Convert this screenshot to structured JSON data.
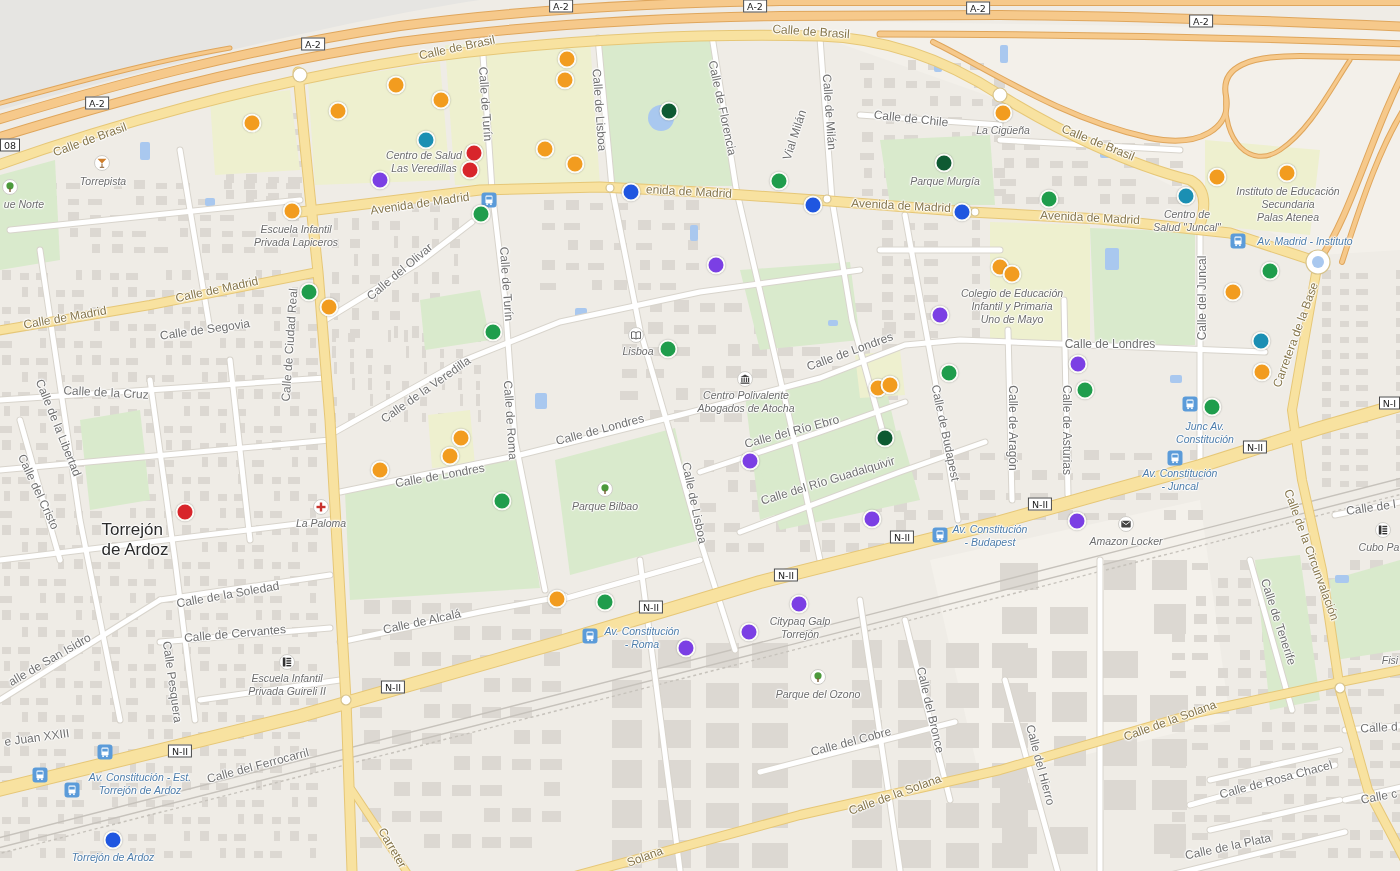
{
  "map": {
    "road_shields": [
      {
        "label": "A-2"
      },
      {
        "label": "A-2"
      },
      {
        "label": "A-2"
      },
      {
        "label": "A-2"
      },
      {
        "label": "A-2"
      },
      {
        "label": "A-2"
      },
      {
        "label": "08"
      },
      {
        "label": "N-I"
      },
      {
        "label": "N-II"
      },
      {
        "label": "N-II"
      },
      {
        "label": "N-II"
      },
      {
        "label": "N-II"
      },
      {
        "label": "N-II"
      },
      {
        "label": "N-II"
      },
      {
        "label": "N-II"
      }
    ],
    "streets": [
      {
        "name": "Calle de Brasil",
        "kind": "major"
      },
      {
        "name": "Calle de Brasil",
        "kind": "major"
      },
      {
        "name": "Calle de Florencia",
        "kind": "minor"
      },
      {
        "name": "Calle de Lisboa",
        "kind": "minor"
      },
      {
        "name": "Calle de Turín",
        "kind": "minor"
      },
      {
        "name": "Calle de Milán",
        "kind": "minor"
      },
      {
        "name": "Calle de Chile",
        "kind": "minor"
      },
      {
        "name": "Calle de Brasil",
        "kind": "major"
      },
      {
        "name": "Vial Milán",
        "kind": "minor"
      },
      {
        "name": "Calle de Brasil",
        "kind": "major"
      },
      {
        "name": "Avenida de Madrid",
        "kind": "major"
      },
      {
        "name": "enida de Madrid",
        "kind": "major"
      },
      {
        "name": "Avenida de Madrid",
        "kind": "major"
      },
      {
        "name": "Avenida de Madrid",
        "kind": "major"
      },
      {
        "name": "Calle del Olivar",
        "kind": "minor"
      },
      {
        "name": "Calle de Madrid",
        "kind": "major"
      },
      {
        "name": "Calle de Turín",
        "kind": "minor"
      },
      {
        "name": "Calle de Madrid",
        "kind": "major"
      },
      {
        "name": "Calle de Segovia",
        "kind": "minor"
      },
      {
        "name": "Carretera de la Base",
        "kind": "major"
      },
      {
        "name": "Calle del Juncal",
        "kind": "minor"
      },
      {
        "name": "Calle de Ciudad Real",
        "kind": "minor"
      },
      {
        "name": "Calle de Londres",
        "kind": "minor"
      },
      {
        "name": "Calle de Londres",
        "kind": "minor"
      },
      {
        "name": "Calle de la Cruz",
        "kind": "minor"
      },
      {
        "name": "Calle de la Veredilla",
        "kind": "minor"
      },
      {
        "name": "Calle de Roma",
        "kind": "minor"
      },
      {
        "name": "Calle de Asturias",
        "kind": "minor"
      },
      {
        "name": "Calle de Aragón",
        "kind": "minor"
      },
      {
        "name": "Calle de Budapest",
        "kind": "minor"
      },
      {
        "name": "Calle de Londres",
        "kind": "minor"
      },
      {
        "name": "Calle del Río Ebro",
        "kind": "minor"
      },
      {
        "name": "Calle de la Libertad",
        "kind": "minor"
      },
      {
        "name": "Calle de Londres",
        "kind": "minor"
      },
      {
        "name": "Calle del Río Guadalquivir",
        "kind": "minor"
      },
      {
        "name": "Calle del Cristo",
        "kind": "minor"
      },
      {
        "name": "Calle de Lisboa",
        "kind": "minor"
      },
      {
        "name": "Calle de l",
        "kind": "minor"
      },
      {
        "name": "Calle de la Circunvalación",
        "kind": "major"
      },
      {
        "name": "Calle de la Soledad",
        "kind": "minor"
      },
      {
        "name": "Calle de Alcalá",
        "kind": "minor"
      },
      {
        "name": "Calle de Tenerife",
        "kind": "minor"
      },
      {
        "name": "Calle de Cervantes",
        "kind": "minor"
      },
      {
        "name": "alle de San Isidro",
        "kind": "minor"
      },
      {
        "name": "Calle Pesquera",
        "kind": "minor"
      },
      {
        "name": "Calle del Bronce",
        "kind": "minor"
      },
      {
        "name": "Calle de la Solana",
        "kind": "major"
      },
      {
        "name": "Calle d",
        "kind": "minor"
      },
      {
        "name": "e Juan XXIII",
        "kind": "minor"
      },
      {
        "name": "Calle del Cobre",
        "kind": "minor"
      },
      {
        "name": "Calle del Hierro",
        "kind": "minor"
      },
      {
        "name": "Calle del Ferrocarril",
        "kind": "minor"
      },
      {
        "name": "Calle de Rosa Chacel",
        "kind": "minor"
      },
      {
        "name": "Calle de la Solana",
        "kind": "major"
      },
      {
        "name": "Calle c",
        "kind": "minor"
      },
      {
        "name": "Calle de la Plata",
        "kind": "minor"
      },
      {
        "name": "Carreter",
        "kind": "major"
      },
      {
        "name": "Solana",
        "kind": "major"
      }
    ],
    "town": {
      "lines": [
        "Torrejón",
        "de Ardoz"
      ]
    },
    "points_of_interest": [
      {
        "kind": "label",
        "lines": [
          "La Cigüeña"
        ]
      },
      {
        "kind": "label",
        "lines": [
          "Centro de Salud",
          "Las Veredillas"
        ]
      },
      {
        "kind": "bar",
        "lines": [
          "Torrepista"
        ]
      },
      {
        "kind": "label",
        "lines": [
          "Parque Murgía"
        ]
      },
      {
        "kind": "park",
        "lines": [
          "ue Norte"
        ]
      },
      {
        "kind": "label",
        "lines": [
          "Instituto de Educación",
          "Secundaria",
          "Palas Atenea"
        ]
      },
      {
        "kind": "label",
        "lines": [
          "Centro de",
          "Salud \"Juncal\""
        ]
      },
      {
        "kind": "label",
        "lines": [
          "Escuela Infantil",
          "Privada Lapiceros"
        ]
      },
      {
        "kind": "bus_stop",
        "lines": [
          "Av. Madrid - Instituto"
        ]
      },
      {
        "kind": "label",
        "lines": [
          "Colegio de Educación",
          "Infantil y Primaria",
          "Uno de Mayo"
        ]
      },
      {
        "kind": "library",
        "lines": [
          "Lisboa"
        ]
      },
      {
        "kind": "museum",
        "lines": [
          "Centro Polivalente",
          "Abogados de Atocha"
        ]
      },
      {
        "kind": "bus_stop",
        "lines": [
          "Junc Av.",
          "Constitución"
        ]
      },
      {
        "kind": "bus_stop",
        "lines": [
          "Av. Constitución",
          "- Juncal"
        ]
      },
      {
        "kind": "park",
        "lines": [
          "Parque Bilbao"
        ]
      },
      {
        "kind": "hospital",
        "lines": [
          "La Paloma"
        ]
      },
      {
        "kind": "bus_stop",
        "lines": [
          "Av. Constitución",
          "- Budapest"
        ]
      },
      {
        "kind": "locker",
        "lines": [
          "Amazon Locker"
        ]
      },
      {
        "kind": "school",
        "lines": [
          "Cubo Pa"
        ]
      },
      {
        "kind": "bus_stop",
        "lines": [
          "Av. Constitución",
          "- Roma"
        ]
      },
      {
        "kind": "label",
        "lines": [
          "Citypaq Galp",
          "Torrejón"
        ]
      },
      {
        "kind": "label",
        "lines": [
          "Fisi"
        ]
      },
      {
        "kind": "school",
        "lines": [
          "Escuela Infantil",
          "Privada Guireli II"
        ]
      },
      {
        "kind": "park",
        "lines": [
          "Parque del Ozono"
        ]
      },
      {
        "kind": "bus_stop",
        "lines": [
          "Av. Constitución - Est.",
          "Torrejón de Ardoz"
        ]
      },
      {
        "kind": "station",
        "lines": [
          "Torrejón de Ardoz"
        ]
      }
    ],
    "markers": [
      {
        "color": "#f29c1f"
      },
      {
        "color": "#f29c1f"
      },
      {
        "color": "#f29c1f"
      },
      {
        "color": "#f29c1f"
      },
      {
        "color": "#f29c1f"
      },
      {
        "color": "#0e5a32"
      },
      {
        "color": "#f29c1f"
      },
      {
        "color": "#f29c1f"
      },
      {
        "color": "#1b8fb3"
      },
      {
        "color": "#f29c1f"
      },
      {
        "color": "#d8252b"
      },
      {
        "color": "#0e5a32"
      },
      {
        "color": "#f29c1f"
      },
      {
        "color": "#d8252b"
      },
      {
        "color": "#f29c1f"
      },
      {
        "color": "#f29c1f"
      },
      {
        "color": "#1f9d4c"
      },
      {
        "color": "#1f56e0"
      },
      {
        "color": "#7b3fe4"
      },
      {
        "color": "#1b8fb3"
      },
      {
        "color": "#1f9d4c"
      },
      {
        "color": "#1f56e0"
      },
      {
        "color": "#f29c1f"
      },
      {
        "color": "#1f56e0"
      },
      {
        "color": "#1f9d4c"
      },
      {
        "color": "#7b3fe4"
      },
      {
        "color": "#f29c1f"
      },
      {
        "color": "#1f9d4c"
      },
      {
        "color": "#f29c1f"
      },
      {
        "color": "#1f9d4c"
      },
      {
        "color": "#f29c1f"
      },
      {
        "color": "#f29c1f"
      },
      {
        "color": "#7b3fe4"
      },
      {
        "color": "#1f9d4c"
      },
      {
        "color": "#1b8fb3"
      },
      {
        "color": "#1f9d4c"
      },
      {
        "color": "#7b3fe4"
      },
      {
        "color": "#f29c1f"
      },
      {
        "color": "#f29c1f"
      },
      {
        "color": "#1f9d4c"
      },
      {
        "color": "#f29c1f"
      },
      {
        "color": "#1f9d4c"
      },
      {
        "color": "#1f9d4c"
      },
      {
        "color": "#f29c1f"
      },
      {
        "color": "#0e5a32"
      },
      {
        "color": "#f29c1f"
      },
      {
        "color": "#7b3fe4"
      },
      {
        "color": "#f29c1f"
      },
      {
        "color": "#1f9d4c"
      },
      {
        "color": "#d8252b"
      },
      {
        "color": "#7b3fe4"
      },
      {
        "color": "#7b3fe4"
      },
      {
        "color": "#f29c1f"
      },
      {
        "color": "#1f9d4c"
      },
      {
        "color": "#7b3fe4"
      },
      {
        "color": "#7b3fe4"
      },
      {
        "color": "#7b3fe4"
      },
      {
        "color": "#1f56e0"
      }
    ]
  }
}
